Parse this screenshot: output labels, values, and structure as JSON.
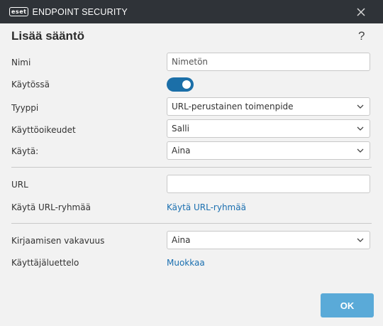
{
  "window": {
    "brand_badge": "eset",
    "brand_name": "ENDPOINT SECURITY",
    "close_icon": "close-icon"
  },
  "dialog": {
    "title": "Lisää sääntö",
    "help": "?"
  },
  "form": {
    "name_label": "Nimi",
    "name_placeholder": "Nimetön",
    "enabled_label": "Käytössä",
    "enabled": true,
    "type_label": "Tyyppi",
    "type_value": "URL-perustainen toimenpide",
    "rights_label": "Käyttöoikeudet",
    "rights_value": "Salli",
    "use_label": "Käytä:",
    "use_value": "Aina",
    "url_label": "URL",
    "url_value": "",
    "url_group_label": "Käytä URL-ryhmää",
    "url_group_link": "Käytä URL-ryhmää",
    "log_label": "Kirjaamisen vakavuus",
    "log_value": "Aina",
    "userlist_label": "Käyttäjäluettelo",
    "userlist_link": "Muokkaa"
  },
  "actions": {
    "ok_label": "OK"
  },
  "colors": {
    "titlebar": "#2f3338",
    "accent": "#1b6fa8",
    "link": "#1a6fb0",
    "ok_button": "#5aaad8"
  }
}
